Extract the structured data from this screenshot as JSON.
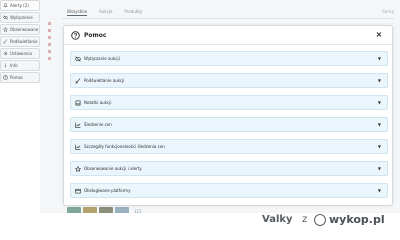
{
  "sidebar": {
    "items": [
      {
        "label": "Alerty (2)",
        "icon": "bell-icon"
      },
      {
        "label": "Wyłączenie",
        "icon": "eye-off-icon"
      },
      {
        "label": "Obserwowane",
        "icon": "star-icon"
      },
      {
        "label": "Podświetlanie",
        "icon": "brush-icon"
      },
      {
        "label": "Ustawienia",
        "icon": "gear-icon"
      },
      {
        "label": "Info",
        "icon": "info-icon"
      },
      {
        "label": "Pomoc",
        "icon": "help-icon"
      }
    ]
  },
  "background": {
    "tabs": [
      "Wszystkie",
      "Aukcje",
      "Produkty"
    ],
    "right_text": "Sortuj",
    "thumbs_label": "115"
  },
  "modal": {
    "title": "Pomoc",
    "close_label": "×",
    "sections": [
      {
        "label": "Wyłączanie aukcji",
        "icon": "eye-off-icon"
      },
      {
        "label": "Podświetlanie aukcji",
        "icon": "brush-icon"
      },
      {
        "label": "Notatki aukcji",
        "icon": "note-icon"
      },
      {
        "label": "Śledzenie cen",
        "icon": "chart-icon"
      },
      {
        "label": "Szczegóły funkcjonalności śledzenia cen",
        "icon": "chart-icon"
      },
      {
        "label": "Obserwowanie aukcji i alerty",
        "icon": "star-icon"
      },
      {
        "label": "Obsługiwane platformy",
        "icon": "platform-icon"
      }
    ]
  },
  "watermark": {
    "user": "Valky",
    "connector": "z",
    "site": "wykop.pl"
  }
}
